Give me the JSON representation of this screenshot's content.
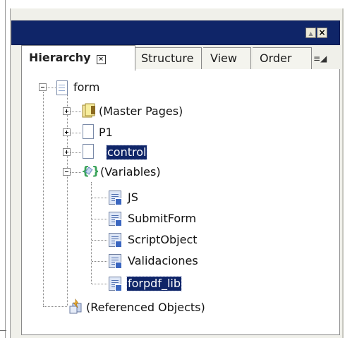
{
  "window": {
    "close_glyph": "×",
    "maximize_glyph": "▲"
  },
  "tabs": {
    "hierarchy": "Hierarchy",
    "hierarchy_close": "×",
    "structure": "Structure",
    "view": "View",
    "order": "Order",
    "menu_glyph": "≡◢"
  },
  "tree": {
    "form": "form",
    "master_pages": "(Master Pages)",
    "p1": "P1",
    "control": "control",
    "variables": "(Variables)",
    "vars": [
      "JS",
      "SubmitForm",
      "ScriptObject",
      "Validaciones",
      "forpdf_lib"
    ],
    "referenced": "(Referenced Objects)"
  },
  "colors": {
    "selection": "#0f2568",
    "titlebar": "#0f2568",
    "variables_brace": "#3aa35a"
  }
}
